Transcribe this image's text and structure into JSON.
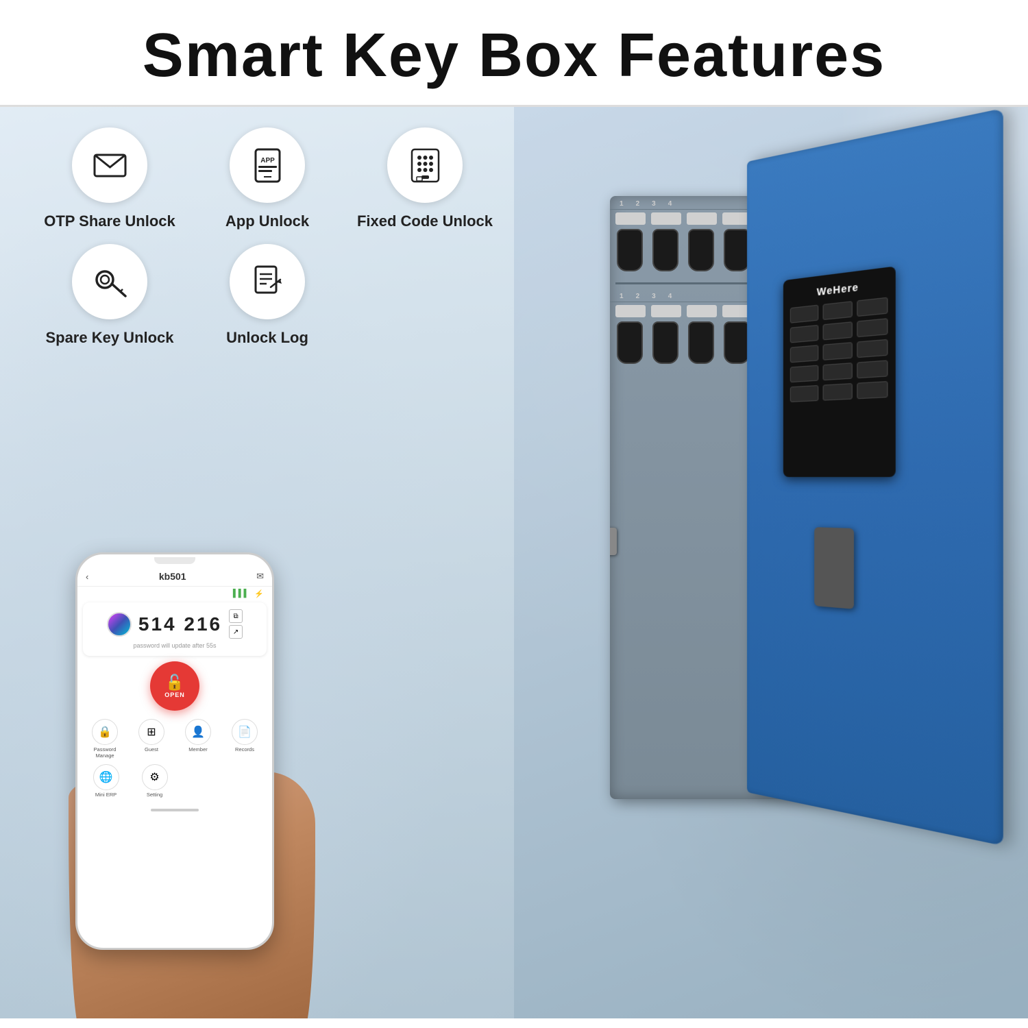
{
  "header": {
    "title": "Smart Key Box Features"
  },
  "features": [
    {
      "id": "otp-share-unlock",
      "label": "OTP Share Unlock",
      "icon": "envelope"
    },
    {
      "id": "app-unlock",
      "label": "App Unlock",
      "icon": "app"
    },
    {
      "id": "fixed-code-unlock",
      "label": "Fixed Code Unlock",
      "icon": "keypad"
    },
    {
      "id": "spare-key-unlock",
      "label": "Spare Key Unlock",
      "icon": "key"
    },
    {
      "id": "unlock-log",
      "label": "Unlock Log",
      "icon": "document"
    }
  ],
  "phone": {
    "device_name": "kb501",
    "otp_code": "514 216",
    "timer_text": "password will update after 55s",
    "open_button_label": "OPEN",
    "menu_items": [
      {
        "label": "Password\nManage",
        "icon": "lock"
      },
      {
        "label": "Guest",
        "icon": "grid"
      },
      {
        "label": "Member",
        "icon": "person"
      },
      {
        "label": "Records",
        "icon": "document"
      }
    ],
    "menu_row2": [
      {
        "label": "Mini ERP",
        "icon": "globe"
      },
      {
        "label": "Setting",
        "icon": "gear"
      }
    ]
  },
  "key_box": {
    "brand": "WeHere",
    "color": "#2e6aaf"
  },
  "detected_text": {
    "records": "Records"
  }
}
